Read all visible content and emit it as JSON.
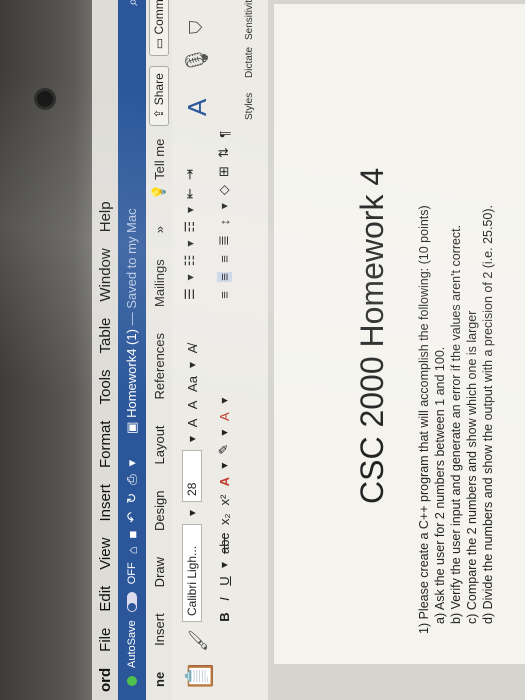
{
  "menubar": {
    "app": "ord",
    "items": [
      "File",
      "Edit",
      "View",
      "Insert",
      "Format",
      "Tools",
      "Table",
      "Window",
      "Help"
    ]
  },
  "titlebar": {
    "autosave_label": "AutoSave",
    "autosave_state": "OFF",
    "doc_name": "Homework4 (1)",
    "saved_status": "— Saved to my Mac"
  },
  "tabs": {
    "items": [
      "ne",
      "Insert",
      "Draw",
      "Design",
      "Layout",
      "References",
      "Mailings"
    ],
    "more": "»",
    "tell_me": "Tell me",
    "share": "Share",
    "comments": "Comments"
  },
  "ribbon": {
    "font_name": "Calibri Ligh...",
    "font_size": "28",
    "grow_font": "A",
    "shrink_font": "A",
    "change_case": "Aa",
    "bold": "B",
    "italic": "I",
    "underline": "U",
    "strikethrough": "abc",
    "subscript": "x₂",
    "superscript": "x²",
    "font_color": "A",
    "styles_label": "Styles",
    "dictate_label": "Dictate",
    "sensitivity_label": "Sensitivity"
  },
  "document": {
    "heading": "CSC 2000 Homework 4",
    "lines": [
      "1)  Please create a C++ program that will accomplish the following: (10 points)",
      "a) Ask the user for 2 numbers between 1 and 100.",
      "b) Verify the user input and generate an error if the values aren't correct.",
      "c) Compare the 2 numbers and show which one is larger",
      "d) Divide the numbers and show the output  with a precision of 2 (i.e. 25.50)."
    ]
  },
  "colors": {
    "titlebar": "#2b579a",
    "autosave_dot": "#4fc04f",
    "font_color_red": "#c0392b"
  }
}
